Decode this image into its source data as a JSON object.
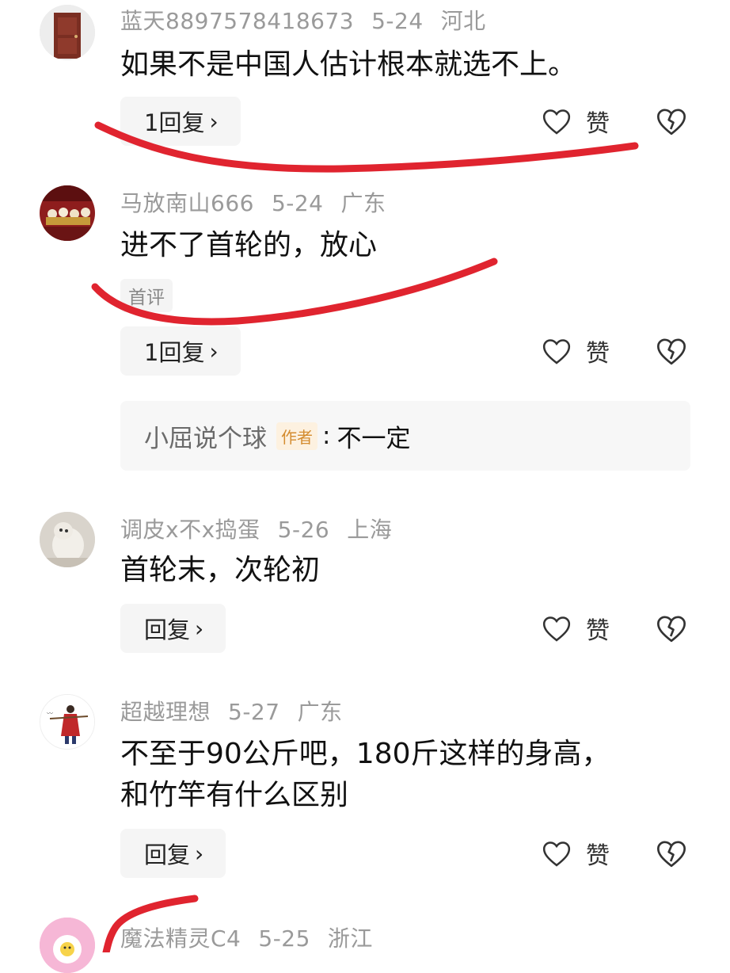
{
  "comments": [
    {
      "user": "蓝天8897578418673",
      "date": "5-24",
      "location": "河北",
      "text": "如果不是中国人估计根本就选不上。",
      "reply_label": "1回复"
    },
    {
      "user": "马放南山666",
      "date": "5-24",
      "location": "广东",
      "text": "进不了首轮的，放心",
      "tag": "首评",
      "reply_label": "1回复",
      "sub_reply": {
        "user": "小屈说个球",
        "badge": "作者",
        "separator": ":",
        "text": "不一定"
      }
    },
    {
      "user": "调皮x不x捣蛋",
      "date": "5-26",
      "location": "上海",
      "text": "首轮末，次轮初",
      "reply_label": "回复"
    },
    {
      "user": "超越理想",
      "date": "5-27",
      "location": "广东",
      "text_line1": "不至于90公斤吧，180斤这样的身高，",
      "text_line2": "和竹竿有什么区别",
      "reply_label": "回复"
    },
    {
      "user": "魔法精灵C4",
      "date": "5-25",
      "location": "浙江"
    }
  ],
  "actions": {
    "chevron": "›",
    "like_label": "赞"
  },
  "colors": {
    "annotation_red": "#e0242f",
    "meta_gray": "#9a9a9a",
    "button_bg": "#f5f5f5",
    "author_badge": "#d48c30"
  },
  "icons": [
    "heart-outline-icon",
    "broken-heart-icon",
    "chevron-right-icon"
  ]
}
